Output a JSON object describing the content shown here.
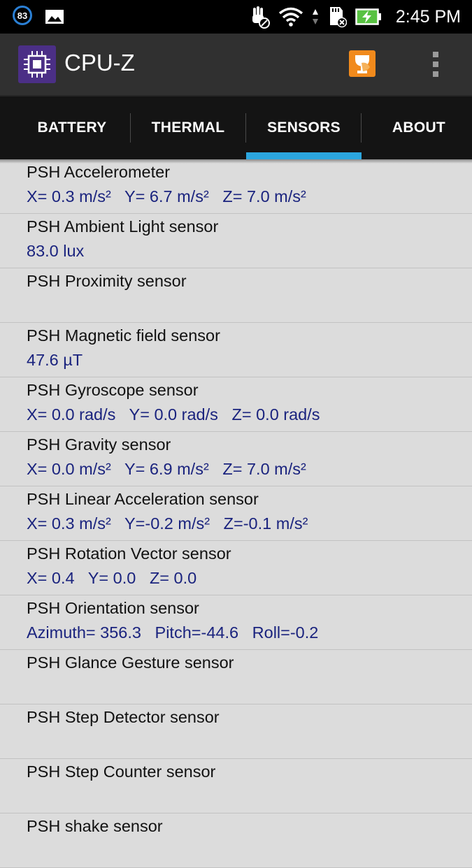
{
  "status_bar": {
    "badge": "83",
    "time": "2:45 PM",
    "icons": [
      "notification-count-icon",
      "image-icon",
      "hand-blocked-icon",
      "wifi-icon",
      "data-arrows-icon",
      "sd-card-icon",
      "battery-charging-icon"
    ]
  },
  "app_bar": {
    "title": "CPU-Z",
    "icons": [
      "cpu-chip-icon",
      "trophy-icon",
      "overflow-menu-icon"
    ]
  },
  "tabs": [
    {
      "label": "BATTERY",
      "active": false
    },
    {
      "label": "THERMAL",
      "active": false
    },
    {
      "label": "SENSORS",
      "active": true
    },
    {
      "label": "ABOUT",
      "active": false
    }
  ],
  "colors": {
    "accent": "#2ba6de",
    "value_text": "#1a237e",
    "list_background": "#dcdcdc"
  },
  "sensors": [
    {
      "name": "PSH Accelerometer",
      "value": "X= 0.3 m/s²   Y= 6.7 m/s²   Z= 7.0 m/s²"
    },
    {
      "name": "PSH Ambient Light sensor",
      "value": "83.0 lux"
    },
    {
      "name": "PSH Proximity sensor",
      "value": ""
    },
    {
      "name": "PSH Magnetic field sensor",
      "value": "47.6 µT"
    },
    {
      "name": "PSH Gyroscope sensor",
      "value": "X= 0.0 rad/s   Y= 0.0 rad/s   Z= 0.0 rad/s"
    },
    {
      "name": "PSH Gravity sensor",
      "value": "X= 0.0 m/s²   Y= 6.9 m/s²   Z= 7.0 m/s²"
    },
    {
      "name": "PSH Linear Acceleration sensor",
      "value": "X= 0.3 m/s²   Y=-0.2 m/s²   Z=-0.1 m/s²"
    },
    {
      "name": "PSH Rotation Vector sensor",
      "value": "X= 0.4   Y= 0.0   Z= 0.0"
    },
    {
      "name": "PSH Orientation sensor",
      "value": "Azimuth= 356.3   Pitch=-44.6   Roll=-0.2"
    },
    {
      "name": "PSH Glance Gesture sensor",
      "value": ""
    },
    {
      "name": "PSH Step Detector sensor",
      "value": ""
    },
    {
      "name": "PSH Step Counter sensor",
      "value": ""
    },
    {
      "name": "PSH shake sensor",
      "value": ""
    }
  ]
}
